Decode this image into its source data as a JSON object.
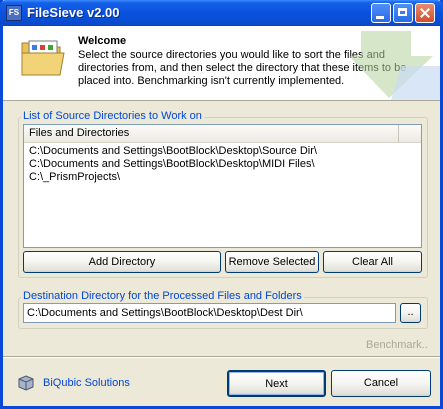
{
  "window": {
    "title": "FileSieve v2.00",
    "icon": "filesieve-app-icon",
    "icon_text": "FS"
  },
  "header": {
    "title": "Welcome",
    "description": "Select the source directories you would like to sort the files and directories from, and then select the directory that these items to be placed into. Benchmarking isn't currently implemented.",
    "icon": "folder-documents-icon"
  },
  "source": {
    "group_label": "List of Source Directories to Work on",
    "column_header": "Files and Directories",
    "items": [
      "C:\\Documents and Settings\\BootBlock\\Desktop\\Source Dir\\",
      "C:\\Documents and Settings\\BootBlock\\Desktop\\MIDI Files\\",
      "C:\\_PrismProjects\\"
    ],
    "add_label": "Add Directory",
    "remove_label": "Remove Selected",
    "clear_label": "Clear All"
  },
  "destination": {
    "group_label": "Destination Directory for the Processed Files and Folders",
    "value": "C:\\Documents and Settings\\BootBlock\\Desktop\\Dest Dir\\",
    "browse_label": ".."
  },
  "benchmark_label": "Benchmark..",
  "footer": {
    "brand": "BiQubic Solutions",
    "next_label": "Next",
    "cancel_label": "Cancel"
  },
  "colors": {
    "titlebar": "#0a52e0",
    "group_label": "#0046d5",
    "disabled_text": "#aca899",
    "dialog_bg": "#ece9d8"
  }
}
